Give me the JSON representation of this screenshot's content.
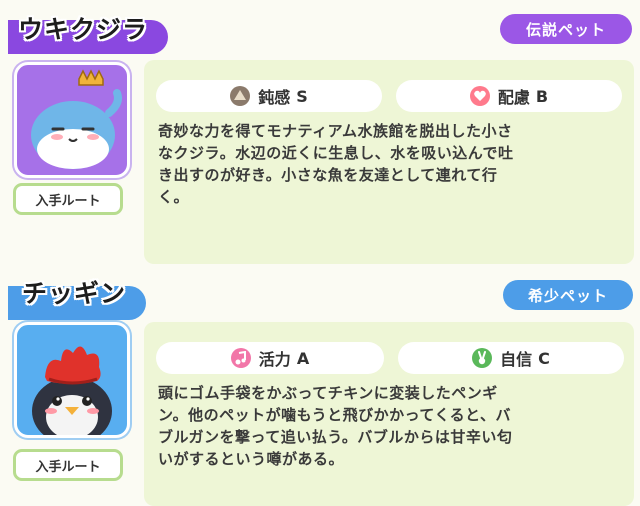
{
  "pets": [
    {
      "name": "ウキクジラ",
      "rarity": "伝説ペット",
      "rarity_color": "#9b57e6",
      "tab_color": "#8a48e0",
      "icon_bg": "#a671e8",
      "icon": "whale-icon",
      "route_label": "入手ルート",
      "stats": [
        {
          "icon": "shell-icon",
          "label": "鈍感",
          "grade": "S"
        },
        {
          "icon": "heart-icon",
          "label": "配慮",
          "grade": "B"
        }
      ],
      "description_lines": [
        "奇妙な力を得てモナティアム水族館を脱出した小さ",
        "なクジラ。水辺の近くに生息し、水を吸い込んで吐",
        "き出すのが好き。小さな魚を友達として連れて行",
        "く。"
      ]
    },
    {
      "name": "チッギン",
      "rarity": "希少ペット",
      "rarity_color": "#4d9de8",
      "tab_color": "#4d9de8",
      "icon_bg": "#58aef0",
      "icon": "penguin-icon",
      "route_label": "入手ルート",
      "stats": [
        {
          "icon": "music-note-icon",
          "label": "活力",
          "grade": "A"
        },
        {
          "icon": "peace-hand-icon",
          "label": "自信",
          "grade": "C"
        }
      ],
      "description_lines": [
        "頭にゴム手袋をかぶってチキンに変装したペンギ",
        "ン。他のペットが噛もうと飛びかかってくると、バ",
        "ブルガンを撃って追い払う。バブルからは甘辛い匂",
        "いがするという噂がある。"
      ]
    }
  ]
}
